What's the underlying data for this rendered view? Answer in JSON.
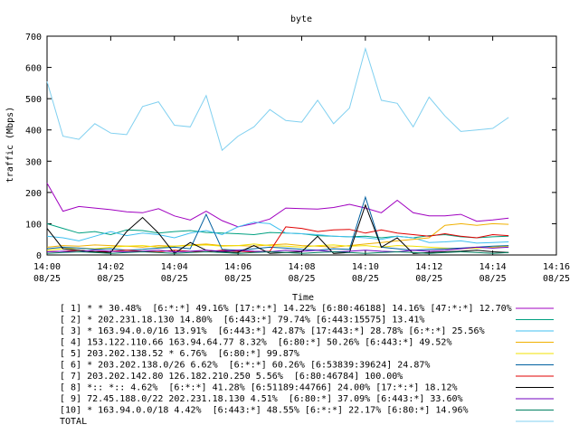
{
  "chart_data": {
    "type": "line",
    "title": "byte",
    "xlabel": "Time",
    "ylabel": "traffic (Mbps)",
    "ylim": [
      0,
      700
    ],
    "yticks": [
      0,
      100,
      200,
      300,
      400,
      500,
      600,
      700
    ],
    "xlim": [
      0,
      16
    ],
    "xticks": [
      {
        "x": 0,
        "time": "14:00",
        "date": "08/25"
      },
      {
        "x": 2,
        "time": "14:02",
        "date": "08/25"
      },
      {
        "x": 4,
        "time": "14:04",
        "date": "08/25"
      },
      {
        "x": 6,
        "time": "14:06",
        "date": "08/25"
      },
      {
        "x": 8,
        "time": "14:08",
        "date": "08/25"
      },
      {
        "x": 10,
        "time": "14:10",
        "date": "08/25"
      },
      {
        "x": 12,
        "time": "14:12",
        "date": "08/25"
      },
      {
        "x": 14,
        "time": "14:14",
        "date": "08/25"
      },
      {
        "x": 16,
        "time": "14:16",
        "date": "08/25"
      }
    ],
    "grid": false,
    "legend_placement": "bottom",
    "x": [
      0,
      0.5,
      1,
      1.5,
      2,
      2.5,
      3,
      3.5,
      4,
      4.5,
      5,
      5.5,
      6,
      6.5,
      7,
      7.5,
      8,
      8.5,
      9,
      9.5,
      10,
      10.5,
      11,
      11.5,
      12,
      12.5,
      13,
      13.5,
      14,
      14.5
    ],
    "series": [
      {
        "name": "[ 1] * * 30.48%  [6:*:*] 49.16% [17:*:*] 14.22% [6:80:46188] 14.16% [47:*:*] 12.70%",
        "color": "#a000c0",
        "values": [
          230,
          140,
          155,
          150,
          145,
          138,
          135,
          148,
          125,
          112,
          140,
          110,
          90,
          100,
          115,
          150,
          148,
          147,
          152,
          162,
          150,
          135,
          175,
          135,
          125,
          125,
          130,
          108,
          112,
          118
        ]
      },
      {
        "name": "[ 2] * 202.231.18.130 14.80%  [6:443:*] 79.74% [6:443:15575] 13.41%",
        "color": "#00a080",
        "values": [
          100,
          85,
          70,
          75,
          65,
          80,
          78,
          70,
          75,
          78,
          72,
          70,
          68,
          65,
          72,
          70,
          68,
          62,
          60,
          58,
          60,
          55,
          60,
          55,
          62,
          65,
          58,
          55,
          58,
          60
        ]
      },
      {
        "name": "[ 3] * 163.94.0.0/16 13.91%  [6:443:*] 42.87% [17:443:*] 28.78% [6:*:*] 25.56%",
        "color": "#40c0f0",
        "values": [
          60,
          55,
          45,
          60,
          75,
          62,
          70,
          65,
          55,
          70,
          78,
          65,
          90,
          105,
          100,
          70,
          68,
          65,
          60,
          58,
          55,
          50,
          60,
          55,
          40,
          42,
          45,
          38,
          40,
          42
        ]
      },
      {
        "name": "[ 4] 153.122.110.66 163.94.64.77 8.32%  [6:80:*] 50.26% [6:443:*] 49.52%",
        "color": "#f0b000",
        "values": [
          25,
          30,
          28,
          32,
          30,
          28,
          25,
          30,
          28,
          32,
          35,
          30,
          30,
          28,
          32,
          35,
          30,
          28,
          25,
          30,
          35,
          40,
          45,
          50,
          55,
          95,
          100,
          95,
          100,
          98
        ]
      },
      {
        "name": "[ 5] 203.202.138.52 * 6.76%  [6:80:*] 99.87%",
        "color": "#f0e000",
        "values": [
          15,
          20,
          22,
          20,
          25,
          28,
          30,
          25,
          28,
          30,
          32,
          28,
          30,
          35,
          30,
          28,
          25,
          30,
          32,
          28,
          30,
          25,
          30,
          28,
          25,
          22,
          20,
          22,
          25,
          28
        ]
      },
      {
        "name": "[ 6] * 203.202.138.0/26 6.62%  [6:*:*] 60.26% [6:53839:39624] 24.87%",
        "color": "#0060a0",
        "values": [
          20,
          25,
          22,
          18,
          20,
          15,
          18,
          22,
          25,
          20,
          130,
          18,
          15,
          20,
          25,
          22,
          18,
          15,
          20,
          18,
          185,
          25,
          20,
          15,
          18,
          20,
          22,
          25,
          28,
          30
        ]
      },
      {
        "name": "[ 7] 203.202.142.80 126.182.210.250 5.56%  [6:80:46784] 100.00%",
        "color": "#e00000",
        "values": [
          10,
          12,
          15,
          10,
          12,
          15,
          12,
          10,
          15,
          12,
          10,
          15,
          12,
          10,
          12,
          90,
          85,
          75,
          80,
          82,
          70,
          80,
          70,
          65,
          60,
          68,
          60,
          55,
          65,
          62
        ]
      },
      {
        "name": "[ 8] *:: *:: 4.62%  [6:*:*] 41.28% [6:51189:44766] 24.00% [17:*:*] 18.12%",
        "color": "#000000",
        "values": [
          85,
          20,
          15,
          10,
          8,
          75,
          120,
          70,
          5,
          40,
          15,
          10,
          8,
          30,
          5,
          8,
          10,
          60,
          5,
          8,
          160,
          25,
          55,
          5,
          8,
          10,
          12,
          15,
          10,
          8
        ]
      },
      {
        "name": "[ 9] 72.45.188.0/22 202.231.18.130 4.51%  [6:80:*] 37.09% [6:443:*] 33.60%",
        "color": "#7000c0",
        "values": [
          10,
          12,
          10,
          15,
          12,
          10,
          12,
          15,
          10,
          12,
          15,
          12,
          15,
          12,
          10,
          15,
          12,
          15,
          10,
          12,
          15,
          12,
          10,
          15,
          12,
          15,
          20,
          25,
          22,
          25
        ]
      },
      {
        "name": "[10] * 163.94.0.0/18 4.42%  [6:443:*] 48.55% [6:*:*] 22.17% [6:80:*] 14.96%",
        "color": "#008060",
        "values": [
          5,
          8,
          10,
          8,
          5,
          8,
          10,
          8,
          5,
          8,
          10,
          8,
          5,
          8,
          10,
          8,
          5,
          8,
          10,
          8,
          5,
          8,
          10,
          8,
          5,
          8,
          10,
          8,
          5,
          8
        ]
      },
      {
        "name": "TOTAL",
        "color": "#80d0f0",
        "values": [
          555,
          380,
          370,
          420,
          390,
          385,
          475,
          490,
          415,
          410,
          510,
          335,
          380,
          410,
          465,
          430,
          425,
          495,
          420,
          470,
          660,
          495,
          485,
          410,
          505,
          445,
          395,
          400,
          405,
          440
        ]
      }
    ]
  }
}
